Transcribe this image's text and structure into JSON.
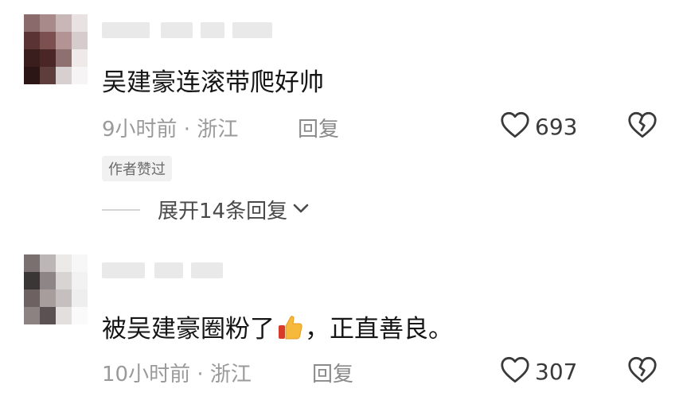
{
  "comments": [
    {
      "text": "吴建豪连滚带爬好帅",
      "time_location": "9小时前 · 浙江",
      "reply_label": "回复",
      "likes": "693",
      "badge": "作者赞过",
      "expand_label": "展开14条回复"
    },
    {
      "text_before": "被吴建豪圈粉了",
      "emoji": "thumbs-up-icon",
      "text_after": "，正直善良。",
      "time_location": "10小时前 · 浙江",
      "reply_label": "回复",
      "likes": "307"
    }
  ],
  "icons": {
    "like": "heart-outline-icon",
    "dislike": "broken-heart-icon",
    "expand": "chevron-down-icon"
  },
  "colors": {
    "text": "#161616",
    "meta": "#9a9a9a",
    "badge_bg": "#f1f1f1"
  }
}
